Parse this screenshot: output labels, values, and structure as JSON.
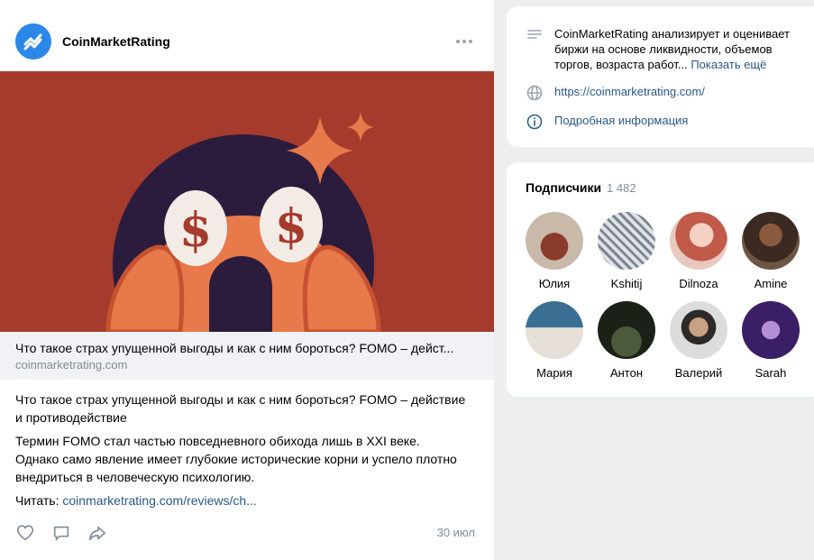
{
  "post": {
    "author": "CoinMarketRating",
    "snippet_title": "Что такое страх упущенной выгоды и как с ним бороться? FOMO – дейст...",
    "snippet_domain": "coinmarketrating.com",
    "title_para": "Что такое страх упущенной выгоды и как с ним бороться? FOMO – действие и противодействие",
    "body_para": "Термин FOMO стал частью повседневного обихода лишь в XXI веке. Однако само явление имеет глубокие исторические корни и успело плотно внедриться в человеческую психологию.",
    "read_label": "Читать:",
    "read_link": "coinmarketrating.com/reviews/ch...",
    "date": "30 июл",
    "icons": [
      "like-icon",
      "comment-icon",
      "share-icon"
    ]
  },
  "info": {
    "description": "CoinMarketRating анализирует и оценивает биржи на основе ликвидности, объемов торгов, возраста работ...",
    "show_more": "Показать ещё",
    "url": "https://coinmarketrating.com/",
    "details": "Подробная информация"
  },
  "subscribers": {
    "title": "Подписчики",
    "count": "1 482",
    "people": [
      {
        "name": "Юлия"
      },
      {
        "name": "Kshitij"
      },
      {
        "name": "Dilnoza"
      },
      {
        "name": "Amine"
      },
      {
        "name": "Мария"
      },
      {
        "name": "Антон"
      },
      {
        "name": "Валерий"
      },
      {
        "name": "Sarah"
      }
    ]
  },
  "colors": {
    "accent": "#2a5885",
    "brand": "#2b87e8",
    "cover_bg": "#a53b2c"
  }
}
